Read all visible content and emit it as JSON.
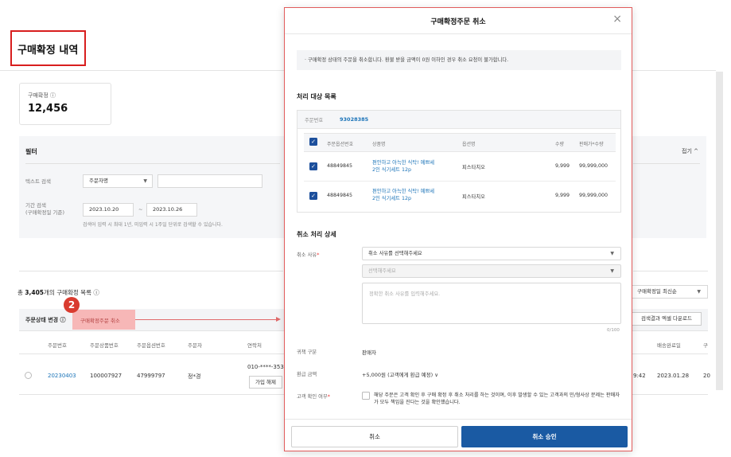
{
  "page": {
    "title": "구매확정 내역",
    "stat": {
      "label": "구매확정 ⓘ",
      "value": "12,456"
    },
    "filter": {
      "title": "필터",
      "collapse_label": "접기 ^",
      "text_search_label": "텍스트 검색",
      "text_search_select": "주문자명",
      "period_label_1": "기간 검색",
      "period_label_2": "(구매확정일 기준)",
      "date_from": "2023.10.20",
      "date_sep": "~",
      "date_to": "2023.10.26",
      "help": "검색어 입력 시 최대 1년, 미입력 시 1주일 단위로 검색할 수 있습니다."
    },
    "list": {
      "title_prefix": "총",
      "count": "3,405",
      "title_suffix": "개의 구매확정 목록 ⓘ",
      "sort_select": "구매확정일 최신순",
      "download_button": "검색결과 엑셀 다운로드",
      "status_label": "주문상태 변경 ⓘ",
      "cancel_button": "구매확정주문 취소",
      "badge": "2",
      "headers": [
        "주문번호",
        "주문상품번호",
        "주문옵션번호",
        "주문자",
        "연락처",
        "배송완료일",
        "구"
      ],
      "row": {
        "order_no": "20230403",
        "product_no": "100007927",
        "option_no": "47999797",
        "orderer": "정*경",
        "phone": "010-****-353",
        "join_button": "가입 해제",
        "time": "9:42",
        "delivered": "2023.01.28",
        "extra": "20"
      }
    }
  },
  "modal": {
    "title": "구매확정주문 취소",
    "close_icon": "×",
    "notice": "· 구매확정 상태의 주문을 취소합니다. 환불 받을 금액이 0원 이하인 경우 취소 요청이 불가합니다.",
    "target_title": "처리 대상 목록",
    "order_label": "주문번호",
    "order_value": "93028385",
    "columns": [
      "주문옵션번호",
      "상품명",
      "옵션명",
      "수량",
      "판매가*수량"
    ],
    "items": [
      {
        "option_no": "48849845",
        "name_1": "편안하고 아늑한 식탁! 예쁘세",
        "name_2": "2인 식기세트 12p",
        "option": "피스타치오",
        "qty": "9,999",
        "price": "99,999,000"
      },
      {
        "option_no": "48849845",
        "name_1": "편안하고 아늑한 식탁! 예쁘세",
        "name_2": "2인 식기세트 12p",
        "option": "피스타치오",
        "qty": "9,999",
        "price": "99,999,000"
      }
    ],
    "detail_title": "취소 처리 상세",
    "reason_label": "취소 사유",
    "reason_select": "취소 사유를 선택해주세요",
    "reason_sub_select": "선택해주세요",
    "reason_placeholder": "정확한 취소 사유를 입력해주세요.",
    "counter": "0/100",
    "fault_label": "귀책 구분",
    "fault_value": "판매자",
    "refund_label": "환급 금액",
    "refund_value": "+5,000원 (고객에게 환급 예정) ∨",
    "confirm_label": "고객 확인 여부",
    "confirm_text": "해당 주문은 고객 확인 후 구매 확정 후 취소 처리를 하는 것이며, 이후 발생할 수 있는 고객과의 민/형사상 문제는 판매자가 모두 책임을 진다는 것을 확인했습니다.",
    "cancel_button": "취소",
    "approve_button": "취소 승인"
  },
  "colors": {
    "accent": "#1a5aa3",
    "highlight": "#d81e1e",
    "link": "#1a73b8"
  }
}
